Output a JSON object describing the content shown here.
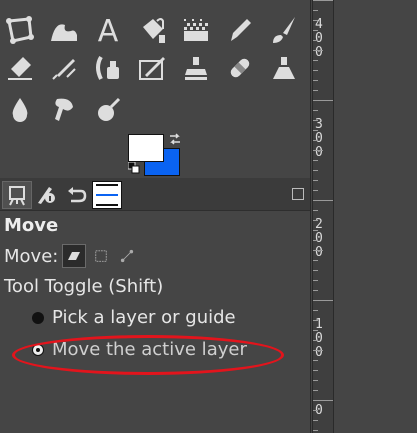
{
  "toolbox": {
    "tools": [
      {
        "name": "paths-icon"
      },
      {
        "name": "heal-warp-icon"
      },
      {
        "name": "text-tool-icon"
      },
      {
        "name": "bucket-fill-icon"
      },
      {
        "name": "gradient-icon"
      },
      {
        "name": "pencil-icon"
      },
      {
        "name": "paintbrush-icon"
      },
      {
        "name": "eraser-icon"
      },
      {
        "name": "airbrush-icon"
      },
      {
        "name": "ink-icon"
      },
      {
        "name": "mypaint-brush-icon"
      },
      {
        "name": "clone-icon"
      },
      {
        "name": "heal-icon"
      },
      {
        "name": "perspective-clone-icon"
      },
      {
        "name": "blur-sharpen-icon"
      },
      {
        "name": "smudge-icon"
      },
      {
        "name": "dodge-burn-icon"
      }
    ],
    "fg_color": "#ffffff",
    "bg_color": "#0a63f2"
  },
  "tabs": [
    {
      "name": "tool-options-tab-icon"
    },
    {
      "name": "device-status-tab-icon"
    },
    {
      "name": "undo-history-tab-icon"
    },
    {
      "name": "images-tab-icon"
    }
  ],
  "tool_options": {
    "title": "Move",
    "move_label": "Move:",
    "toggle_label": "Tool Toggle  (Shift)",
    "option_pick": "Pick a layer or guide",
    "option_move": "Move the active layer"
  },
  "ruler": {
    "numbers": [
      "4",
      "0",
      "0",
      "3",
      "0",
      "0",
      "2",
      "0",
      "0",
      "1",
      "0",
      "0",
      "0"
    ]
  },
  "annotation": {
    "color": "#e3141c"
  }
}
